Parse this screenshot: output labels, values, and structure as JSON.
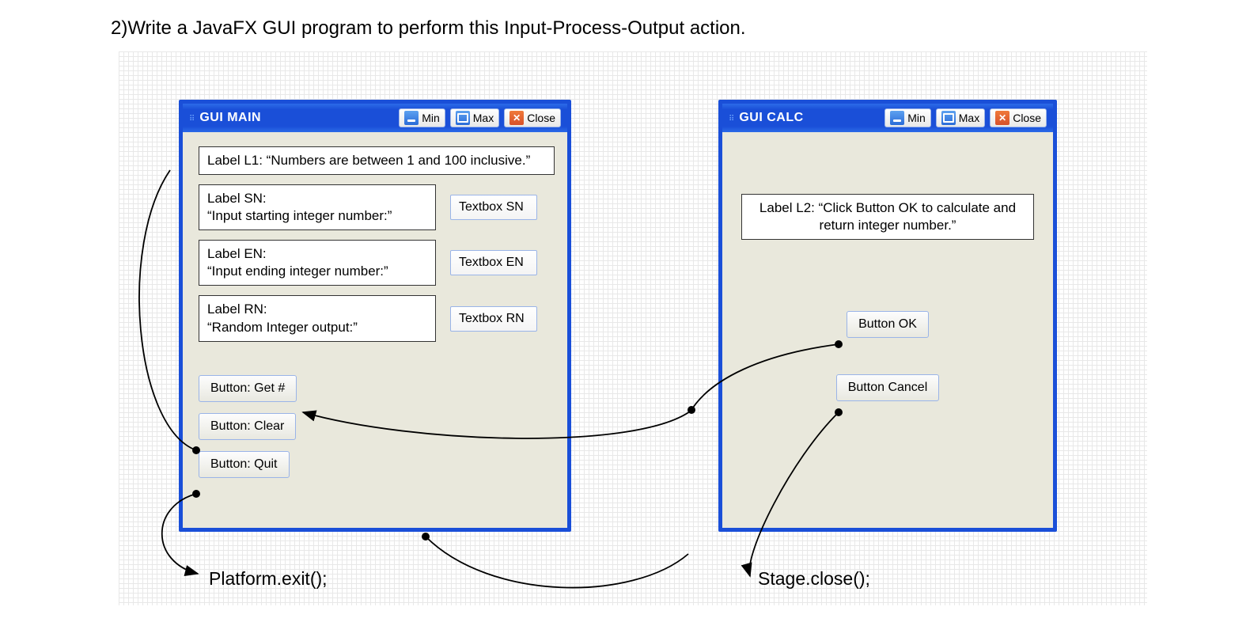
{
  "question": "2)Write a JavaFX GUI program to perform this Input-Process-Output action.",
  "winMain": {
    "title": "GUI MAIN",
    "minLabel": "Min",
    "maxLabel": "Max",
    "closeLabel": "Close",
    "labelL1": "Label L1: “Numbers are between 1 and 100 inclusive.”",
    "labelSN_line1": "Label SN:",
    "labelSN_line2": "“Input starting integer number:”",
    "textboxSN": "Textbox SN",
    "labelEN_line1": "Label EN:",
    "labelEN_line2": "“Input ending integer number:”",
    "textboxEN": "Textbox EN",
    "labelRN_line1": "Label RN:",
    "labelRN_line2": "“Random Integer output:”",
    "textboxRN": "Textbox RN",
    "btnGet": "Button: Get #",
    "btnClear": "Button: Clear",
    "btnQuit": "Button: Quit"
  },
  "winCalc": {
    "title": "GUI CALC",
    "minLabel": "Min",
    "maxLabel": "Max",
    "closeLabel": "Close",
    "labelL2": "Label L2: “Click Button OK to calculate and return integer number.”",
    "btnOK": "Button OK",
    "btnCancel": "Button Cancel"
  },
  "annot": {
    "platformExit": "Platform.exit();",
    "stageClose": "Stage.close();"
  }
}
